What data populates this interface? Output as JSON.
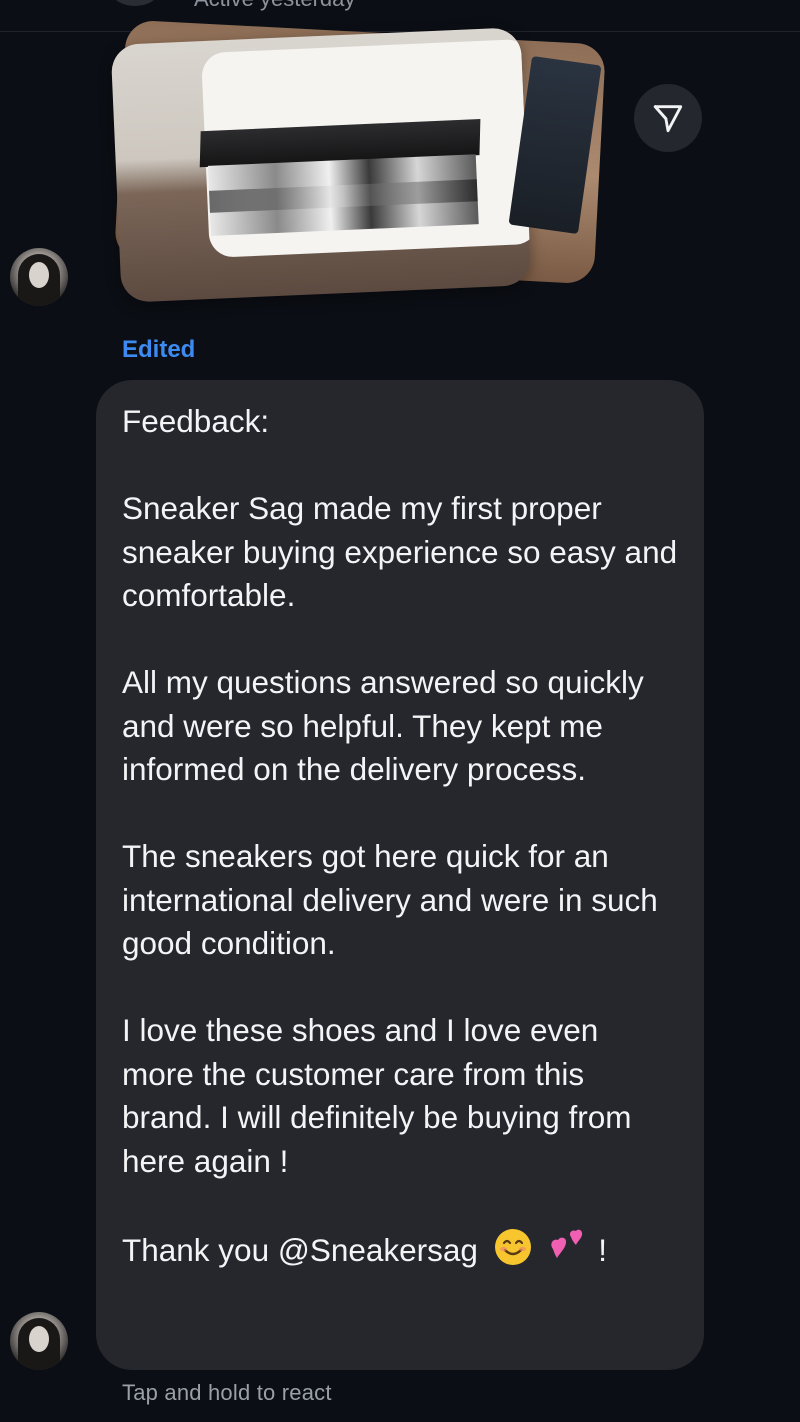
{
  "header": {
    "status": "Active yesterday"
  },
  "message_photo": {
    "alt_icon": "shared-photo-shoebox"
  },
  "share_button": {
    "icon": "paper-plane-icon"
  },
  "message": {
    "edited_label": "Edited",
    "paragraphs": [
      "Feedback:",
      "Sneaker Sag made my first proper sneaker buying experience so easy and comfortable.",
      "All my questions answered so quickly and were so helpful. They kept me informed on the delivery process.",
      "The sneakers got here quick for an international delivery and were in such good condition.",
      "I love these shoes and I  love even more  the customer care from this brand. I will definitely be buying from here again !"
    ],
    "closing": "Thank you @Sneakersag",
    "closing_end": "!",
    "emojis": [
      "smiling-face-emoji",
      "two-hearts-emoji"
    ]
  },
  "footer": {
    "hint": "Tap and hold to react"
  },
  "colors": {
    "background": "#0b0e14",
    "bubble": "#25272d",
    "accent_blue": "#3d8bf2",
    "text": "#f4f4f6",
    "muted": "#9aa0a8"
  }
}
